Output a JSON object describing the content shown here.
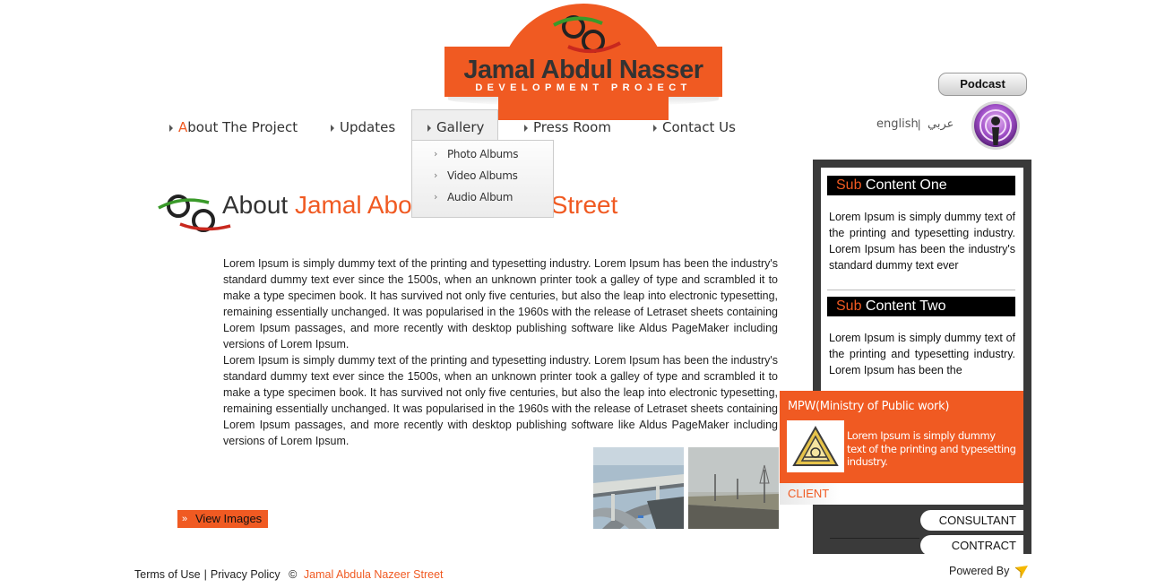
{
  "logo": {
    "title": "Jamal Abdul Nasser",
    "subtitle": "DEVELOPMENT PROJECT"
  },
  "nav": {
    "items": [
      {
        "first_letter": "A",
        "rest": "bout The Project"
      },
      {
        "label": "Updates"
      },
      {
        "label": "Gallery"
      },
      {
        "label": "Press Room"
      },
      {
        "label": "Contact Us"
      }
    ],
    "gallery_dropdown": [
      "Photo Albums",
      "Video Albums",
      "Audio Album"
    ]
  },
  "language": {
    "english": "english",
    "separator": "|",
    "arabic": "عربي"
  },
  "podcast": {
    "label": "Podcast"
  },
  "main": {
    "heading_prefix": "About",
    "heading_highlight_start": "Jamal Abo",
    "heading_highlight_end": "Street",
    "paragraphs": [
      "Lorem Ipsum is simply dummy text of the printing and typesetting industry. Lorem Ipsum has been the industry's standard dummy text ever since the 1500s, when an unknown printer took a galley of type and scrambled it to make a type specimen book. It has survived not only five centuries, but also the leap into electronic typesetting, remaining essentially unchanged. It was popularised in the 1960s with the release of Letraset sheets containing Lorem Ipsum passages, and more recently with desktop publishing software like Aldus PageMaker including versions of Lorem Ipsum.",
      "Lorem Ipsum is simply dummy text of the printing and typesetting industry. Lorem Ipsum has been the industry's standard dummy text ever since the 1500s, when an unknown printer took a galley of type and scrambled it to make a type specimen book. It has survived not only five centuries, but also the leap into electronic typesetting, remaining essentially unchanged. It was popularised in the 1960s with the release of Letraset sheets containing Lorem Ipsum passages, and more recently with desktop publishing software like Aldus PageMaker including versions of Lorem Ipsum."
    ],
    "view_images_label": "View Images"
  },
  "sidebar": {
    "sub_one": {
      "title_highlight": "Sub",
      "title_rest": "Content One",
      "text": "Lorem Ipsum is simply dummy text of the printing and typesetting industry. Lorem Ipsum has been the industry's standard dummy text ever"
    },
    "sub_two": {
      "title_highlight": "Sub",
      "title_rest": "Content Two",
      "text": "Lorem Ipsum is simply dummy text of the printing and typesetting industry. Lorem Ipsum has been the"
    },
    "mpw": {
      "title": "MPW(Ministry of Public work)",
      "text": "Lorem Ipsum is simply dummy text of the printing and typesetting industry."
    },
    "tabs": {
      "client": "CLIENT",
      "consultant": "CONSULTANT",
      "contract": "CONTRACT"
    }
  },
  "footer": {
    "terms": "Terms of Use",
    "separator": "|",
    "privacy": "Privacy Policy",
    "copyright_symbol": "©",
    "brand": "Jamal Abdula Nazeer Street",
    "powered_by": "Powered By"
  },
  "colors": {
    "accent": "#f05a22",
    "sidebar_dark": "#3a3a3a"
  }
}
